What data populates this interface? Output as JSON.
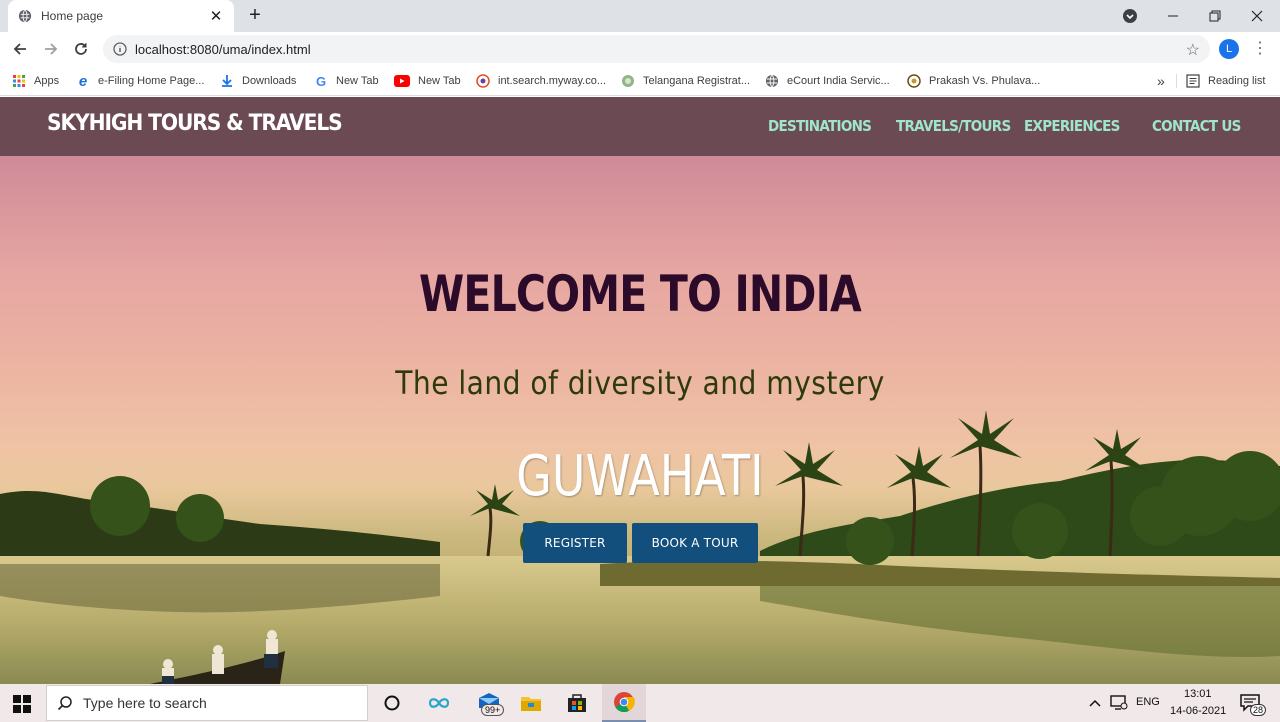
{
  "browser": {
    "tab_title": "Home page",
    "tab_close": "✕",
    "new_tab": "+",
    "url": "localhost:8080/uma/index.html",
    "avatar_letter": "L",
    "bookmarks": [
      {
        "label": "Apps"
      },
      {
        "label": "e-Filing Home Page..."
      },
      {
        "label": "Downloads"
      },
      {
        "label": "New Tab"
      },
      {
        "label": "New Tab"
      },
      {
        "label": "int.search.myway.co..."
      },
      {
        "label": "Telangana Registrat..."
      },
      {
        "label": "eCourt India Servic..."
      },
      {
        "label": "Prakash Vs. Phulava..."
      }
    ],
    "bookmarks_overflow": "»",
    "reading_list": "Reading list"
  },
  "site": {
    "brand": "SKYHIGH TOURS & TRAVELS",
    "nav": [
      "DESTINATIONS",
      "TRAVELS/TOURS",
      "EXPERIENCES",
      "CONTACT US"
    ],
    "hero_title": "WELCOME TO INDIA",
    "hero_subtitle": "The land of diversity and mystery",
    "hero_city": "GUWAHATI",
    "buttons": {
      "register": "REGISTER",
      "book": "BOOK A TOUR"
    },
    "colors": {
      "nav_bg": "#6b4a54",
      "nav_link": "#9fe5cc",
      "button": "#134f7d"
    }
  },
  "taskbar": {
    "search_placeholder": "Type here to search",
    "mail_badge": "99+",
    "language": "ENG",
    "time": "13:01",
    "date": "14-06-2021",
    "notifications": "28"
  }
}
